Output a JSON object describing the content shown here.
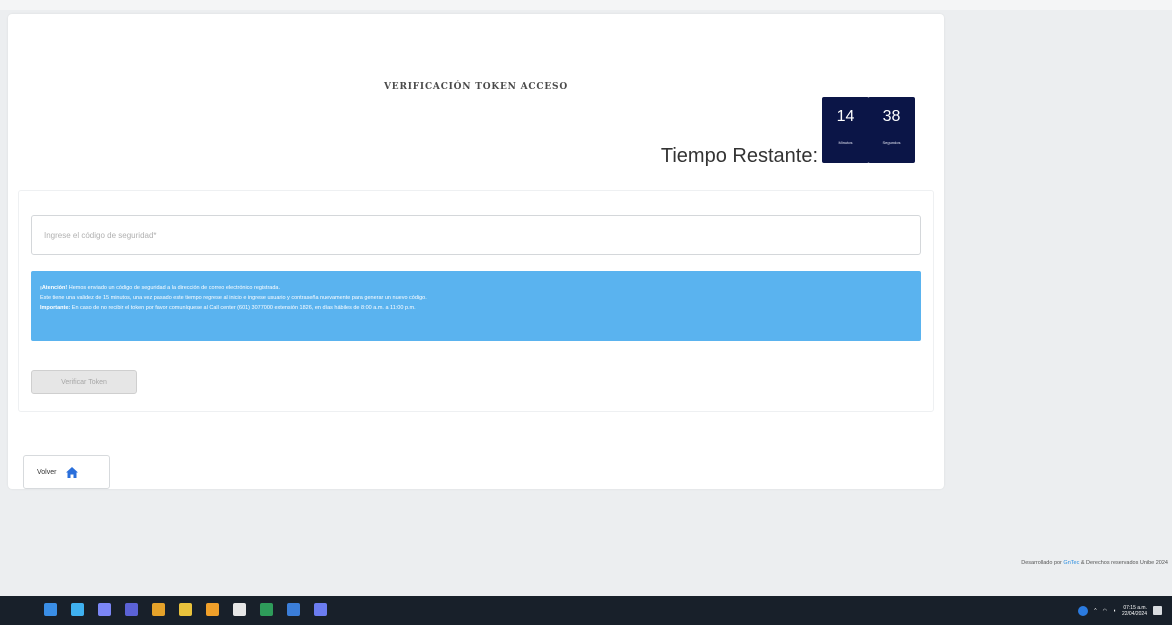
{
  "card": {
    "title": "VERIFICACIÓN TOKEN ACCESO"
  },
  "timer": {
    "label": "Tiempo Restante:",
    "minutes": "14",
    "minutes_unit": "Minutos",
    "seconds": "38",
    "seconds_unit": "Segundos"
  },
  "form": {
    "code_placeholder": "Ingrese el código de seguridad*",
    "code_value": "",
    "alert_line1_bold": "¡Atención!",
    "alert_line1": " Hemos enviado un código de seguridad a la dirección de correo electrónico registrada.",
    "alert_line2": "Este tiene una validez de 15 minutos, una vez pasado este tiempo regrese al inicio e ingrese usuario y contraseña nuevamente para generar un nuevo código.",
    "alert_line3_bold": "Importante:",
    "alert_line3": " En caso de no recibir el token por favor comuníquese al Call center (601) 3077000 extensión 1826, en días hábiles de 8:00 a.m. a 11:00 p.m.",
    "verify_label": "Verificar Token"
  },
  "back": {
    "label": "Volver",
    "icon": "home-icon"
  },
  "footer": {
    "prefix": "Desarrollado por ",
    "link": "GnTec",
    "suffix": " & Derechos reservados Unibe 2024"
  },
  "taskbar": {
    "time": "07:15 a.m.",
    "date": "22/04/2024",
    "icons": [
      {
        "name": "start-icon",
        "color": "#3a8ee6"
      },
      {
        "name": "search-icon",
        "color": "#3fb1f0"
      },
      {
        "name": "task-view-icon",
        "color": "#7b86f5"
      },
      {
        "name": "teams-icon",
        "color": "#5b62d6"
      },
      {
        "name": "chrome-icon",
        "color": "#e5a22a"
      },
      {
        "name": "mail-icon",
        "color": "#e9c23c"
      },
      {
        "name": "files-icon",
        "color": "#f0a02a"
      },
      {
        "name": "acrobat-icon",
        "color": "#e6e6e6"
      },
      {
        "name": "excel-icon",
        "color": "#2e9c5a"
      },
      {
        "name": "word-icon",
        "color": "#3b7ed9"
      },
      {
        "name": "app-icon",
        "color": "#6b7cf0"
      }
    ]
  }
}
